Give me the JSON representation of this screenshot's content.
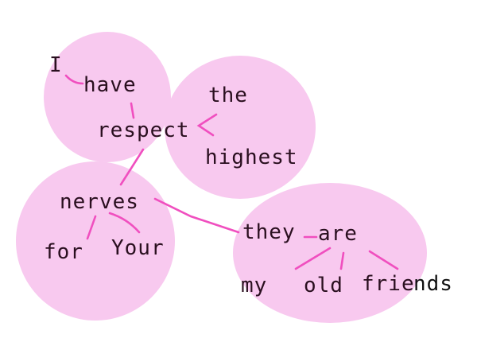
{
  "colors": {
    "bubble": "#f8c9ef",
    "link": "#f04fbf",
    "ink": "#2a0f1f",
    "background": "#ffffff"
  },
  "words": {
    "I": "I",
    "have": "have",
    "respect": "respect",
    "the": "the",
    "highest": "highest",
    "nerves": "nerves",
    "for": "for",
    "your": "Your",
    "they": "they",
    "are": "are",
    "my": "my",
    "old": "old",
    "friends_main": "frie",
    "friends_tail": "nds"
  }
}
